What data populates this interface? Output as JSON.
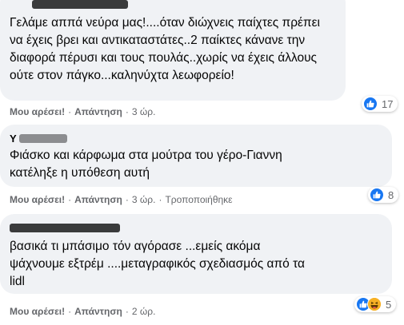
{
  "comments": [
    {
      "author_initial": "",
      "text": "Γελάμε αππά νεύρα μας!....όταν διώχνεις παίχτες πρέπει\nνα έχεις βρει και αντικαταστάτες..2 παίκτες κάνανε την\nδιαφορά πέρυσι και τους πουλάς..χωρίς να έχεις άλλους\nούτε στον πάγκο...καληνύχτα λεωφορείο!",
      "like_label": "Μου αρέσει!",
      "reply_label": "Απάντηση",
      "time": "3 ώρ.",
      "edited": "",
      "reactions": [
        "like-icon"
      ],
      "reaction_count": "17"
    },
    {
      "author_initial": "Y",
      "text": "Φιάσκο και κάρφωμα στα μούτρα του γέρο-Γιαννη\nκατέληξε η υπόθεση αυτή",
      "like_label": "Μου αρέσει!",
      "reply_label": "Απάντηση",
      "time": "3 ώρ.",
      "edited": "Τροποποιήθηκε",
      "reactions": [
        "like-icon"
      ],
      "reaction_count": "8"
    },
    {
      "author_initial": "",
      "text": "βασικά τι μπάσιμο τόν αγόρασε ...εμείς ακόμα\nψάχνουμε εξτρέμ ....μεταγραφικός σχεδιασμός από τα\nlidl",
      "like_label": "Μου αρέσει!",
      "reply_label": "Απάντηση",
      "time": "2 ώρ.",
      "edited": "",
      "reactions": [
        "like-icon",
        "haha-icon"
      ],
      "reaction_count": "5"
    }
  ],
  "colors": {
    "bubble": "#f0f2f5",
    "like_blue": "#1877f2",
    "haha_yellow": "#f7b125",
    "meta_gray": "#65676b"
  }
}
